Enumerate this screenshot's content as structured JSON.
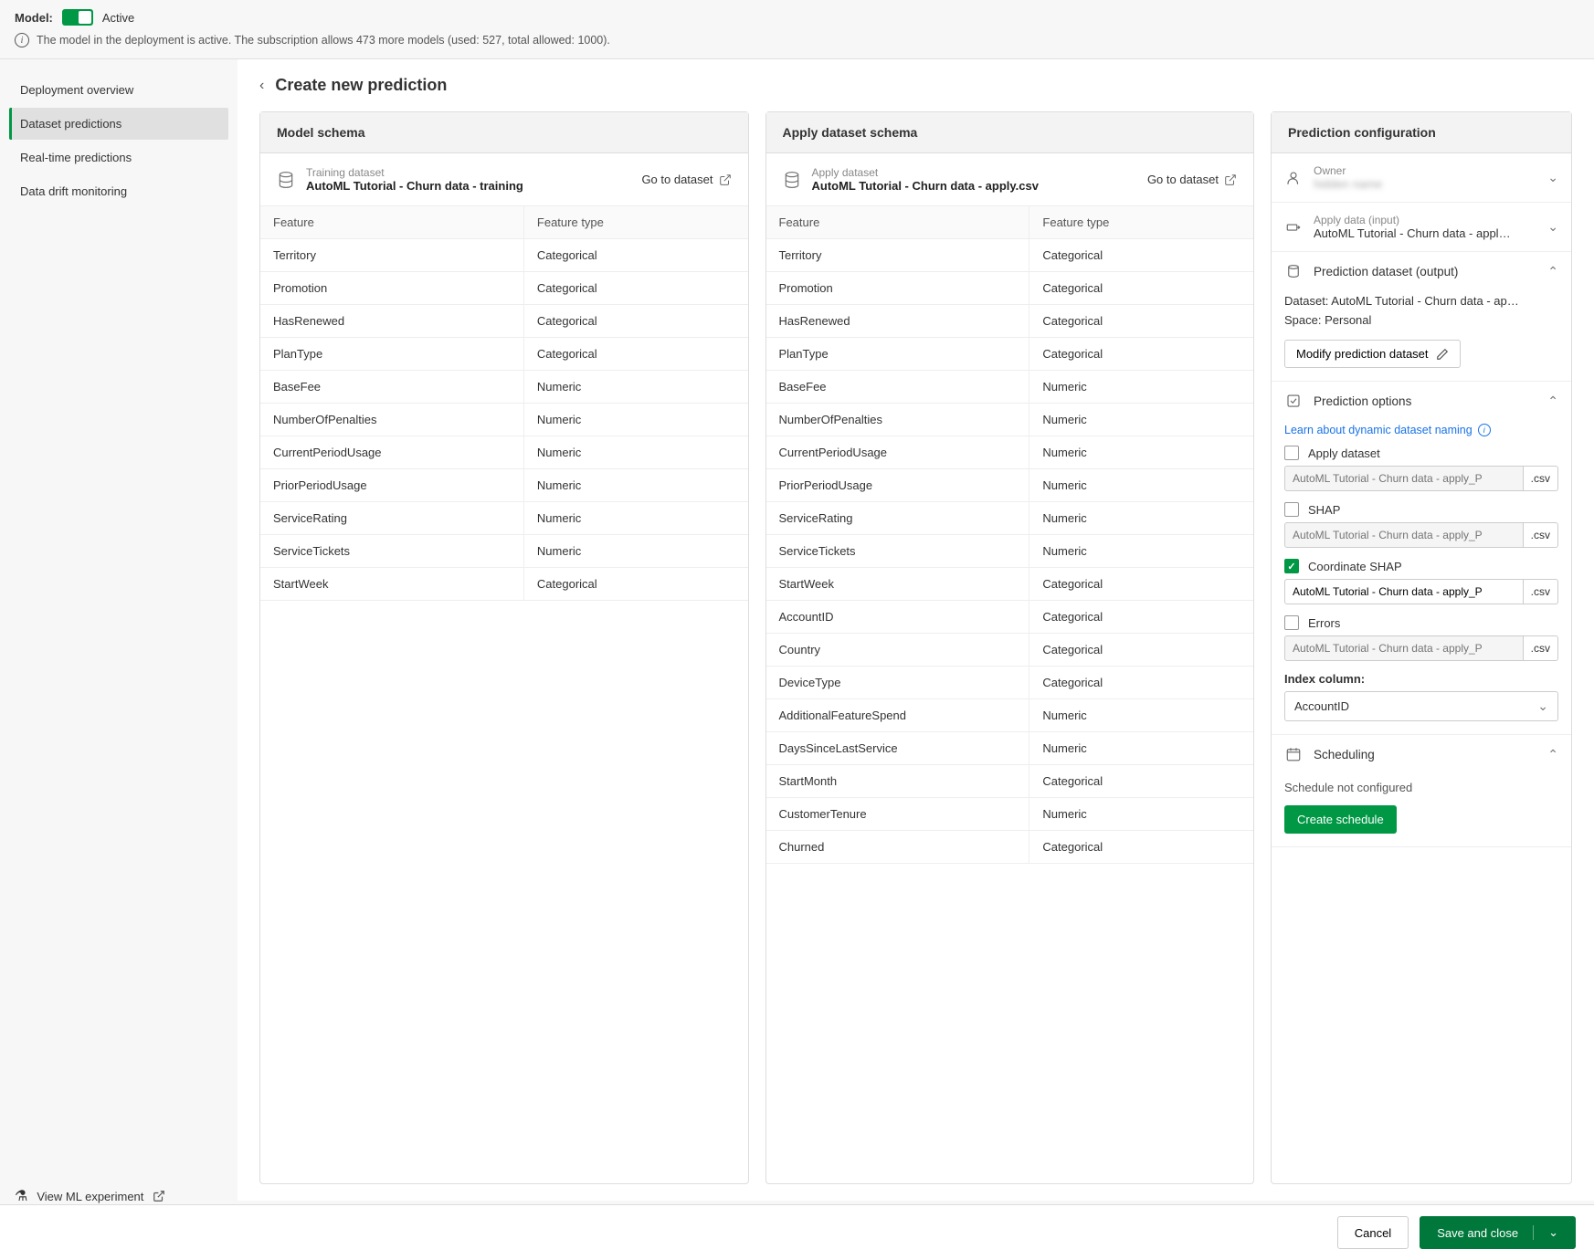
{
  "topbar": {
    "model_label": "Model:",
    "status": "Active",
    "info_text": "The model in the deployment is active. The subscription allows 473 more models (used: 527, total allowed: 1000)."
  },
  "sidebar": {
    "items": [
      {
        "label": "Deployment overview",
        "active": false
      },
      {
        "label": "Dataset predictions",
        "active": true
      },
      {
        "label": "Real-time predictions",
        "active": false
      },
      {
        "label": "Data drift monitoring",
        "active": false
      }
    ],
    "footer_label": "View ML experiment"
  },
  "page": {
    "title": "Create new prediction"
  },
  "model_schema": {
    "title": "Model schema",
    "ds_label": "Training dataset",
    "ds_name": "AutoML Tutorial - Churn data - training",
    "goto": "Go to dataset",
    "col_feature": "Feature",
    "col_type": "Feature type",
    "rows": [
      {
        "feature": "Territory",
        "type": "Categorical"
      },
      {
        "feature": "Promotion",
        "type": "Categorical"
      },
      {
        "feature": "HasRenewed",
        "type": "Categorical"
      },
      {
        "feature": "PlanType",
        "type": "Categorical"
      },
      {
        "feature": "BaseFee",
        "type": "Numeric"
      },
      {
        "feature": "NumberOfPenalties",
        "type": "Numeric"
      },
      {
        "feature": "CurrentPeriodUsage",
        "type": "Numeric"
      },
      {
        "feature": "PriorPeriodUsage",
        "type": "Numeric"
      },
      {
        "feature": "ServiceRating",
        "type": "Numeric"
      },
      {
        "feature": "ServiceTickets",
        "type": "Numeric"
      },
      {
        "feature": "StartWeek",
        "type": "Categorical"
      }
    ]
  },
  "apply_schema": {
    "title": "Apply dataset schema",
    "ds_label": "Apply dataset",
    "ds_name": "AutoML Tutorial - Churn data - apply.csv",
    "goto": "Go to dataset",
    "col_feature": "Feature",
    "col_type": "Feature type",
    "rows": [
      {
        "feature": "Territory",
        "type": "Categorical"
      },
      {
        "feature": "Promotion",
        "type": "Categorical"
      },
      {
        "feature": "HasRenewed",
        "type": "Categorical"
      },
      {
        "feature": "PlanType",
        "type": "Categorical"
      },
      {
        "feature": "BaseFee",
        "type": "Numeric"
      },
      {
        "feature": "NumberOfPenalties",
        "type": "Numeric"
      },
      {
        "feature": "CurrentPeriodUsage",
        "type": "Numeric"
      },
      {
        "feature": "PriorPeriodUsage",
        "type": "Numeric"
      },
      {
        "feature": "ServiceRating",
        "type": "Numeric"
      },
      {
        "feature": "ServiceTickets",
        "type": "Numeric"
      },
      {
        "feature": "StartWeek",
        "type": "Categorical"
      },
      {
        "feature": "AccountID",
        "type": "Categorical"
      },
      {
        "feature": "Country",
        "type": "Categorical"
      },
      {
        "feature": "DeviceType",
        "type": "Categorical"
      },
      {
        "feature": "AdditionalFeatureSpend",
        "type": "Numeric"
      },
      {
        "feature": "DaysSinceLastService",
        "type": "Numeric"
      },
      {
        "feature": "StartMonth",
        "type": "Categorical"
      },
      {
        "feature": "CustomerTenure",
        "type": "Numeric"
      },
      {
        "feature": "Churned",
        "type": "Categorical"
      }
    ]
  },
  "config": {
    "title": "Prediction configuration",
    "owner": {
      "label": "Owner",
      "value": "hidden name"
    },
    "apply_input": {
      "label": "Apply data (input)",
      "value": "AutoML Tutorial - Churn data - appl…"
    },
    "pred_dataset": {
      "title": "Prediction dataset (output)",
      "dataset_line": "Dataset: AutoML Tutorial - Churn data - ap…",
      "space_line": "Space: Personal",
      "modify_btn": "Modify prediction dataset"
    },
    "options": {
      "title": "Prediction options",
      "learn_link": "Learn about dynamic dataset naming",
      "ext": ".csv",
      "apply": {
        "label": "Apply dataset",
        "checked": false,
        "value": "",
        "placeholder": "AutoML Tutorial - Churn data - apply_P"
      },
      "shap": {
        "label": "SHAP",
        "checked": false,
        "value": "",
        "placeholder": "AutoML Tutorial - Churn data - apply_P"
      },
      "coord_shap": {
        "label": "Coordinate SHAP",
        "checked": true,
        "value": "AutoML Tutorial - Churn data - apply_P"
      },
      "errors": {
        "label": "Errors",
        "checked": false,
        "value": "",
        "placeholder": "AutoML Tutorial - Churn data - apply_P"
      },
      "index_label": "Index column:",
      "index_value": "AccountID"
    },
    "scheduling": {
      "title": "Scheduling",
      "text": "Schedule not configured",
      "btn": "Create schedule"
    }
  },
  "footer": {
    "cancel": "Cancel",
    "save": "Save and close"
  }
}
